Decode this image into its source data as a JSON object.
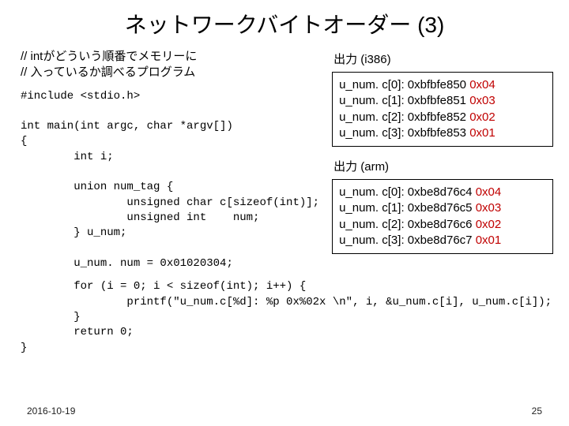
{
  "title": "ネットワークバイトオーダー (3)",
  "comment_line1": "// intがどういう順番でメモリーに",
  "comment_line2": "// 入っているか調べるプログラム",
  "code_top": "#include <stdio.h>\n\nint main(int argc, char *argv[])\n{\n        int i;\n\n        union num_tag {\n                unsigned char c[sizeof(int)];\n                unsigned int    num;\n        } u_num;\n\n        u_num. num = 0x01020304;",
  "code_wide": "        for (i = 0; i < sizeof(int); i++) {\n                printf(\"u_num.c[%d]: %p 0x%02x \\n\", i, &u_num.c[i], u_num.c[i]);\n        }\n        return 0;\n}",
  "out1": {
    "head": "出力 (i386)",
    "rows": [
      {
        "label": "u_num. c[0]: 0xbfbfe850 ",
        "val": "0x04"
      },
      {
        "label": "u_num. c[1]: 0xbfbfe851 ",
        "val": "0x03"
      },
      {
        "label": "u_num. c[2]: 0xbfbfe852 ",
        "val": "0x02"
      },
      {
        "label": "u_num. c[3]: 0xbfbfe853 ",
        "val": "0x01"
      }
    ]
  },
  "out2": {
    "head": "出力 (arm)",
    "rows": [
      {
        "label": "u_num. c[0]: 0xbe8d76c4 ",
        "val": "0x04"
      },
      {
        "label": "u_num. c[1]: 0xbe8d76c5 ",
        "val": "0x03"
      },
      {
        "label": "u_num. c[2]: 0xbe8d76c6 ",
        "val": "0x02"
      },
      {
        "label": "u_num. c[3]: 0xbe8d76c7 ",
        "val": "0x01"
      }
    ]
  },
  "footer_left": "2016-10-19",
  "footer_right": "25"
}
